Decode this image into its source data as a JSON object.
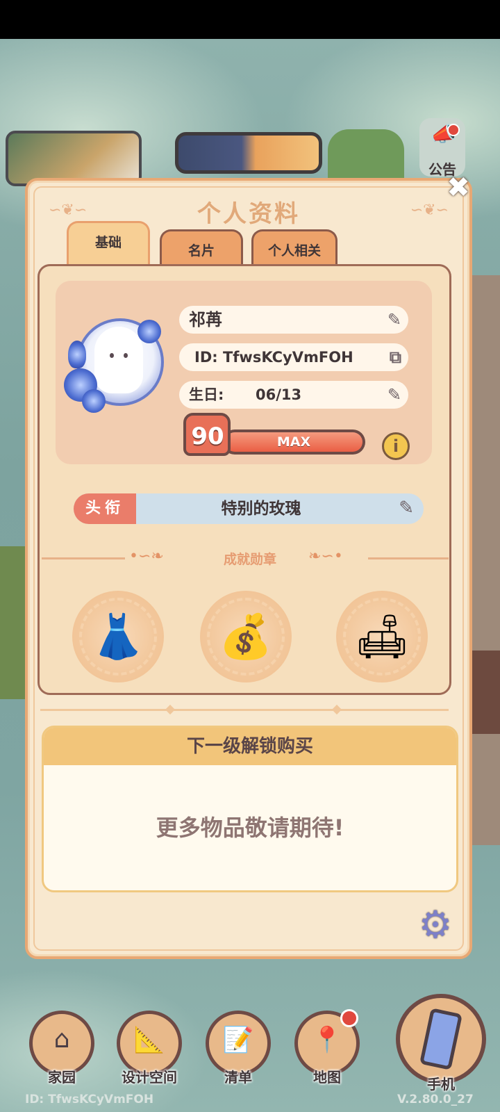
{
  "hud": {
    "notice_label": "公告"
  },
  "modal": {
    "title": "个人资料",
    "close_glyph": "✖"
  },
  "tabs": [
    {
      "label": "基础",
      "active": true
    },
    {
      "label": "名片",
      "active": false
    },
    {
      "label": "个人相关",
      "active": false
    }
  ],
  "profile": {
    "name": "祁苒",
    "id_text": "ID: TfwsKCyVmFOH",
    "birthday_label": "生日:",
    "birthday_value": "06/13",
    "level": "90",
    "level_status": "MAX",
    "level_progress": 1.0
  },
  "title_row": {
    "tag": "头衔",
    "value": "特别的玫瑰"
  },
  "achievements": {
    "label": "成就勋章",
    "medals": [
      "dress-icon",
      "money-bag-icon",
      "armchair-icon"
    ]
  },
  "unlock": {
    "header": "下一级解锁购买",
    "body": "更多物品敬请期待!"
  },
  "nav": {
    "home": "家园",
    "design": "设计空间",
    "list": "清单",
    "map": "地图",
    "phone": "手机"
  },
  "footer": {
    "id": "ID: TfwsKCyVmFOH",
    "version": "V.2.80.0_27"
  },
  "colors": {
    "modal_bg": "#f8e8cf",
    "accent_orange": "#eda26a",
    "level_red": "#ea5f45",
    "title_tag": "#ea7d6a",
    "unlock_header": "#f2c57a"
  }
}
